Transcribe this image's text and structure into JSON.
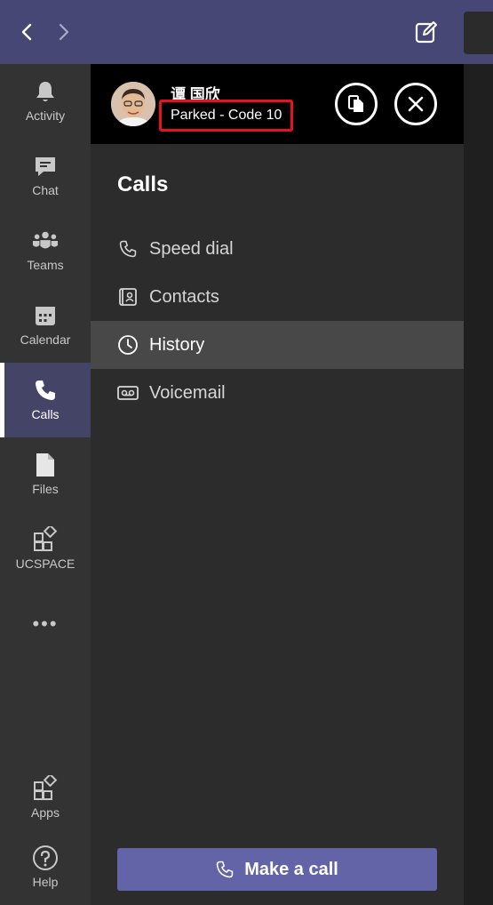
{
  "colors": {
    "titlebar": "#464775",
    "rail": "#333333",
    "rail_active": "#444566",
    "panel": "#2d2c2c",
    "callbar": "#000000",
    "highlight_border": "#e81123",
    "primary_button": "#6264a7",
    "active_row": "#484848"
  },
  "titlebar": {
    "back_icon": "chevron-left-icon",
    "forward_icon": "chevron-right-icon",
    "compose_icon": "compose-icon"
  },
  "rail": {
    "items": [
      {
        "label": "Activity",
        "icon": "bell-icon"
      },
      {
        "label": "Chat",
        "icon": "chat-icon"
      },
      {
        "label": "Teams",
        "icon": "teams-icon"
      },
      {
        "label": "Calendar",
        "icon": "calendar-icon"
      },
      {
        "label": "Calls",
        "icon": "phone-icon",
        "active": true
      },
      {
        "label": "Files",
        "icon": "file-icon"
      },
      {
        "label": "UCSPACE",
        "icon": "app-grid-icon"
      }
    ],
    "more": "•••",
    "bottom": [
      {
        "label": "Apps",
        "icon": "apps-icon"
      },
      {
        "label": "Help",
        "icon": "help-icon"
      }
    ]
  },
  "call": {
    "caller_name": "谭 国欣",
    "status": "Parked - Code 10",
    "transfer_icon": "transfer-icon",
    "end_icon": "close-icon"
  },
  "panel": {
    "title": "Calls",
    "items": [
      {
        "label": "Speed dial",
        "icon": "phone-icon"
      },
      {
        "label": "Contacts",
        "icon": "contact-card-icon"
      },
      {
        "label": "History",
        "icon": "clock-icon",
        "active": true
      },
      {
        "label": "Voicemail",
        "icon": "voicemail-icon"
      }
    ],
    "make_call_label": "Make a call"
  }
}
